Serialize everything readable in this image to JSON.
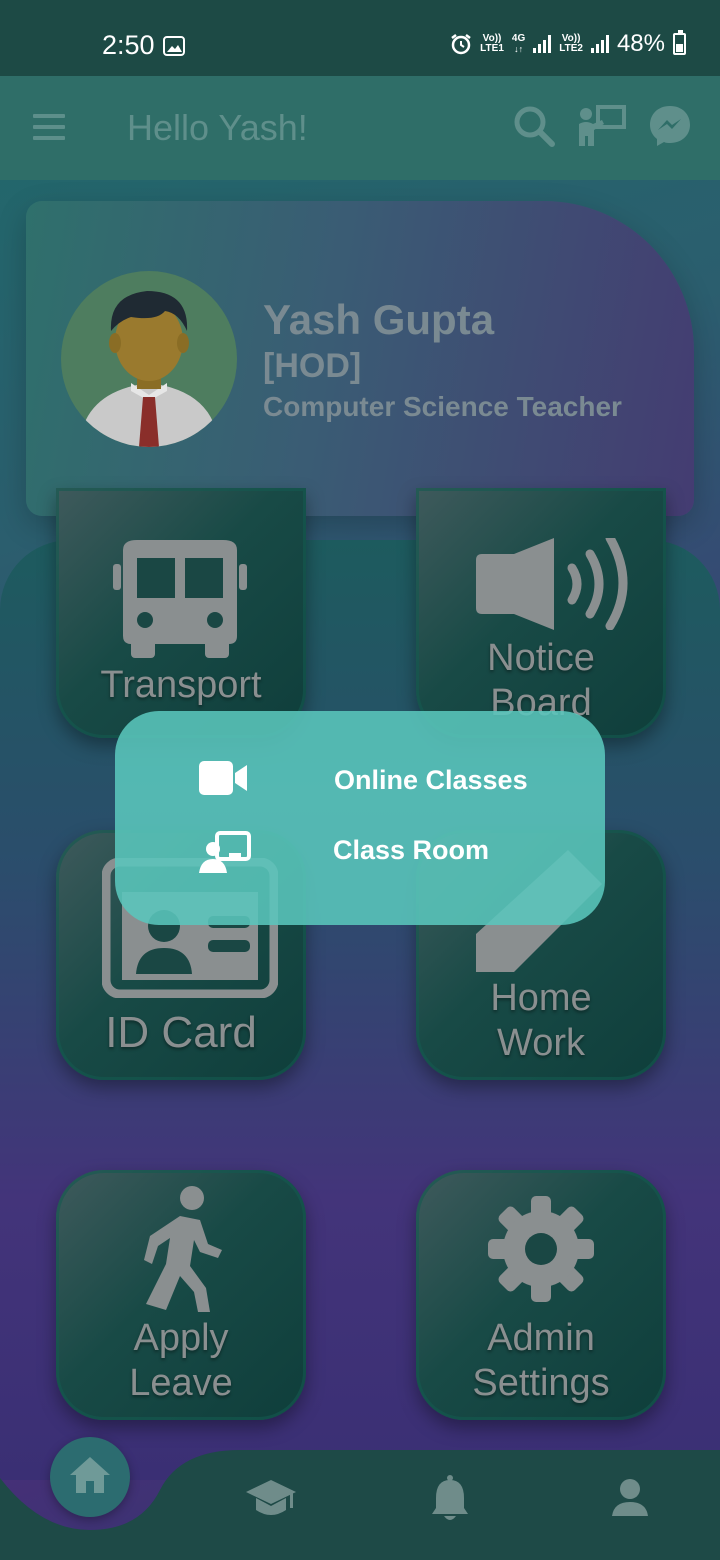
{
  "status_bar": {
    "time": "2:50",
    "net1_top": "Vo))",
    "net1_bottom": "LTE1",
    "net_4g": "4G",
    "net2_top": "Vo))",
    "net2_bottom": "LTE2",
    "battery": "48%"
  },
  "app_bar": {
    "greeting": "Hello Yash!",
    "icons": [
      "search-icon",
      "teacher-icon",
      "messenger-icon"
    ]
  },
  "profile": {
    "name": "Yash Gupta",
    "role": "[HOD]",
    "subject": "Computer Science Teacher"
  },
  "tiles": [
    {
      "label": "Transport",
      "icon": "bus-icon"
    },
    {
      "label": "Notice Board",
      "icon": "megaphone-icon"
    },
    {
      "label": "ID Card",
      "icon": "id-card-icon"
    },
    {
      "label": "Home Work",
      "icon": "pencil-icon"
    },
    {
      "label": "Apply Leave",
      "icon": "walking-icon"
    },
    {
      "label": "Admin Settings",
      "icon": "gear-icon"
    }
  ],
  "popup": {
    "items": [
      {
        "label": "Online Classes",
        "icon": "video-camera-icon"
      },
      {
        "label": "Class Room",
        "icon": "classroom-icon"
      }
    ]
  },
  "bottom_nav": {
    "items": [
      "home-icon",
      "graduation-cap-icon",
      "bell-icon",
      "user-icon"
    ]
  },
  "colors": {
    "status_bar": "#1d4a45",
    "app_bar": "#2f6e68",
    "popup": "#5ac6bc",
    "tile_text": "#8a8f90"
  }
}
